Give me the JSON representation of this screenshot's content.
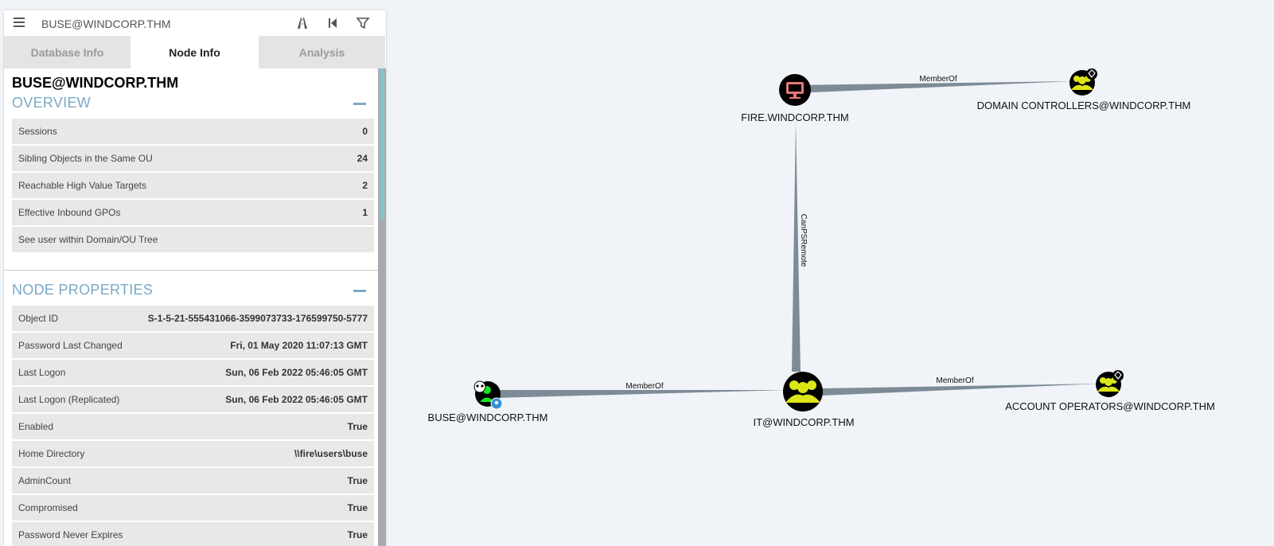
{
  "search": {
    "value": "BUSE@WINDCORP.THM"
  },
  "tabs": [
    {
      "label": "Database Info"
    },
    {
      "label": "Node Info"
    },
    {
      "label": "Analysis"
    }
  ],
  "node_title": "BUSE@WINDCORP.THM",
  "overview": {
    "title": "OVERVIEW",
    "rows": [
      {
        "label": "Sessions",
        "value": "0"
      },
      {
        "label": "Sibling Objects in the Same OU",
        "value": "24"
      },
      {
        "label": "Reachable High Value Targets",
        "value": "2"
      },
      {
        "label": "Effective Inbound GPOs",
        "value": "1"
      },
      {
        "label": "See user within Domain/OU Tree",
        "value": ""
      }
    ]
  },
  "node_properties": {
    "title": "NODE PROPERTIES",
    "rows": [
      {
        "label": "Object ID",
        "value": "S-1-5-21-555431066-3599073733-176599750-5777"
      },
      {
        "label": "Password Last Changed",
        "value": "Fri, 01 May 2020 11:07:13 GMT"
      },
      {
        "label": "Last Logon",
        "value": "Sun, 06 Feb 2022 05:46:05 GMT"
      },
      {
        "label": "Last Logon (Replicated)",
        "value": "Sun, 06 Feb 2022 05:46:05 GMT"
      },
      {
        "label": "Enabled",
        "value": "True"
      },
      {
        "label": "Home Directory",
        "value": "\\\\fire\\users\\buse"
      },
      {
        "label": "AdminCount",
        "value": "True"
      },
      {
        "label": "Compromised",
        "value": "True"
      },
      {
        "label": "Password Never Expires",
        "value": "True"
      }
    ]
  },
  "graph": {
    "nodes": {
      "fire": {
        "label": "FIRE.WINDCORP.THM",
        "icon": "computer-icon"
      },
      "dc": {
        "label": "DOMAIN CONTROLLERS@WINDCORP.THM",
        "icon": "group-icon"
      },
      "it": {
        "label": "IT@WINDCORP.THM",
        "icon": "group-icon"
      },
      "buse": {
        "label": "BUSE@WINDCORP.THM",
        "icon": "user-icon"
      },
      "ao": {
        "label": "ACCOUNT OPERATORS@WINDCORP.THM",
        "icon": "group-icon"
      }
    },
    "edges": {
      "fire_dc": "MemberOf",
      "it_fire": "CanPSRemote",
      "buse_it": "MemberOf",
      "it_ao": "MemberOf"
    }
  },
  "colors": {
    "edge": "#7d8b96",
    "group_fill": "#dbe617",
    "user_fill": "#17e625",
    "computer_fill": "#e67873",
    "accent": "#7aa9c8"
  }
}
